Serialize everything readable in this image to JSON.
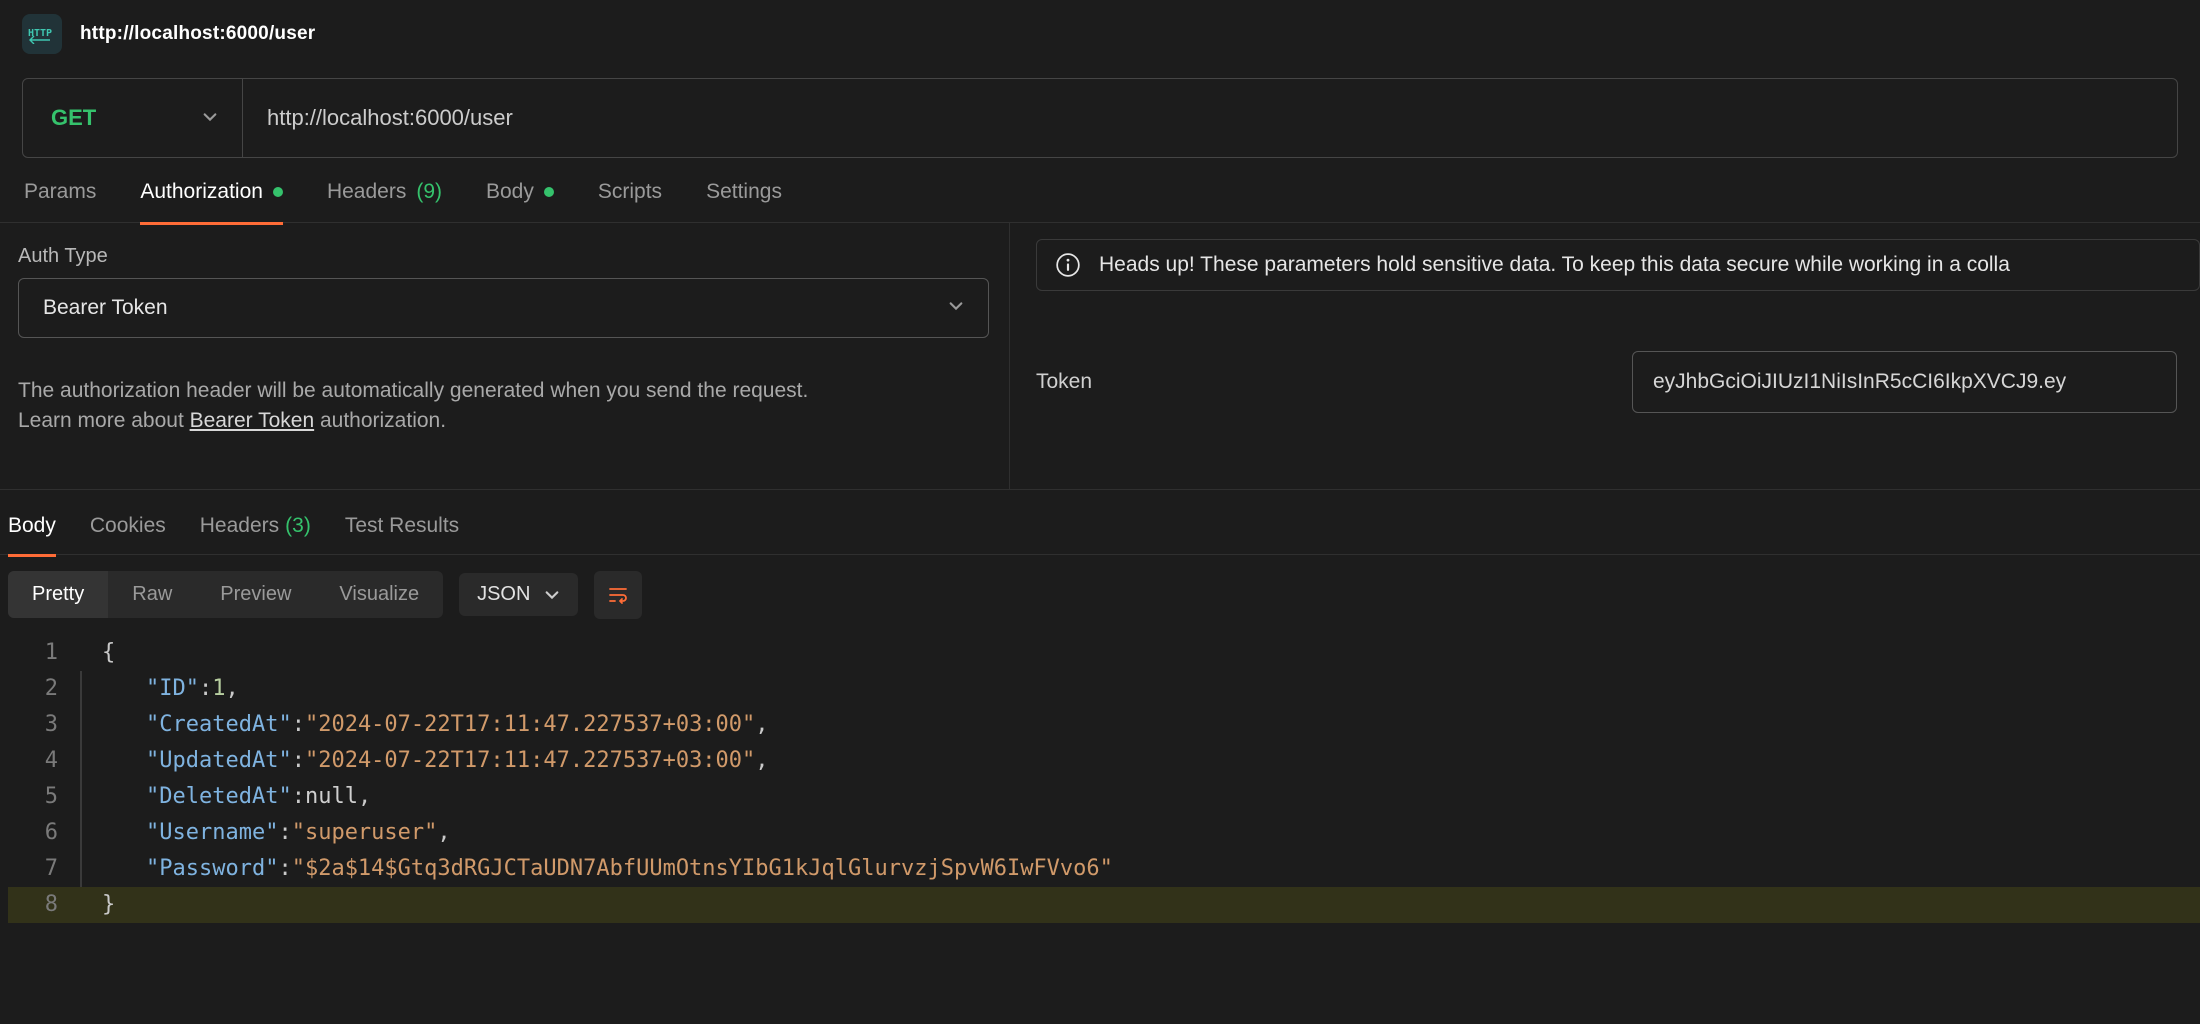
{
  "title": "http://localhost:6000/user",
  "request": {
    "method": "GET",
    "url": "http://localhost:6000/user"
  },
  "req_tabs": {
    "params": "Params",
    "authorization": "Authorization",
    "headers": "Headers",
    "headers_count": "(9)",
    "body": "Body",
    "scripts": "Scripts",
    "settings": "Settings"
  },
  "auth": {
    "type_label": "Auth Type",
    "type_value": "Bearer Token",
    "blurb_1": "The authorization header will be automatically generated when you send the request.",
    "blurb_2a": "Learn more about ",
    "blurb_link": "Bearer Token",
    "blurb_2b": " authorization.",
    "alert": "Heads up! These parameters hold sensitive data. To keep this data secure while working in a colla",
    "token_label": "Token",
    "token_value": "eyJhbGciOiJIUzI1NiIsInR5cCI6IkpXVCJ9.ey"
  },
  "resp_tabs": {
    "body": "Body",
    "cookies": "Cookies",
    "headers": "Headers",
    "headers_count": "(3)",
    "tests": "Test Results"
  },
  "viewmodes": {
    "pretty": "Pretty",
    "raw": "Raw",
    "preview": "Preview",
    "visualize": "Visualize",
    "format": "JSON"
  },
  "response_json": {
    "ID": 1,
    "CreatedAt": "2024-07-22T17:11:47.227537+03:00",
    "UpdatedAt": "2024-07-22T17:11:47.227537+03:00",
    "DeletedAt": null,
    "Username": "superuser",
    "Password": "$2a$14$Gtq3dRGJCTaUDN7AbfUUmOtnsYIbG1kJqlGlurvzjSpvW6IwFVvo6"
  },
  "code_lines": [
    "1",
    "2",
    "3",
    "4",
    "5",
    "6",
    "7",
    "8"
  ]
}
